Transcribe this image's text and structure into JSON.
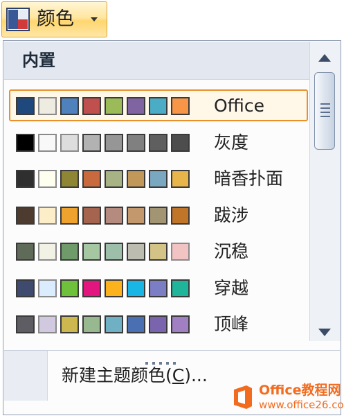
{
  "ribbon": {
    "label": "颜色",
    "icon": "theme-colors-icon"
  },
  "panel": {
    "section_title": "内置",
    "themes": [
      {
        "name": "Office",
        "selected": true,
        "colors": [
          "#1f497d",
          "#eeece1",
          "#4f81bd",
          "#c0504d",
          "#9bbb59",
          "#8064a2",
          "#4bacc6",
          "#f79646"
        ]
      },
      {
        "name": "灰度",
        "selected": false,
        "colors": [
          "#000000",
          "#f8f8f8",
          "#dddddd",
          "#b2b2b2",
          "#969696",
          "#808080",
          "#5f5f5f",
          "#4d4d4d"
        ]
      },
      {
        "name": "暗香扑面",
        "selected": false,
        "colors": [
          "#2f2f2f",
          "#fffff0",
          "#8e8635",
          "#c86a3e",
          "#a7b285",
          "#c19859",
          "#7aa8c0",
          "#e8b54a"
        ]
      },
      {
        "name": "跋涉",
        "selected": false,
        "colors": [
          "#4e3b30",
          "#fbeec9",
          "#f0a22e",
          "#a5644e",
          "#b58b80",
          "#c3986d",
          "#a19574",
          "#c17529"
        ]
      },
      {
        "name": "沉稳",
        "selected": false,
        "colors": [
          "#5f6a58",
          "#f1f1e6",
          "#6f9a6a",
          "#a5c7a2",
          "#9dbea9",
          "#bcbcb0",
          "#d3c386",
          "#f2c3c3"
        ]
      },
      {
        "name": "穿越",
        "selected": false,
        "colors": [
          "#3e4a6e",
          "#dcecff",
          "#6fc13c",
          "#e2167e",
          "#fbb21d",
          "#19b5e4",
          "#7b7dc5",
          "#1fb59b"
        ]
      },
      {
        "name": "顶峰",
        "selected": false,
        "colors": [
          "#5d5d63",
          "#d1c9e0",
          "#cdb74f",
          "#98b98f",
          "#6fb0c4",
          "#4a6fb3",
          "#7b64ae",
          "#a07fc2"
        ]
      }
    ],
    "scrollbar": {
      "up_icon": "scroll-up-arrow-icon",
      "down_icon": "scroll-down-arrow-icon"
    },
    "footer": {
      "command_prefix": "新建主题颜色(",
      "command_key": "C",
      "command_suffix": ")..."
    }
  },
  "watermark": {
    "line1": "Office教程网",
    "line2": "www.office26.com"
  }
}
